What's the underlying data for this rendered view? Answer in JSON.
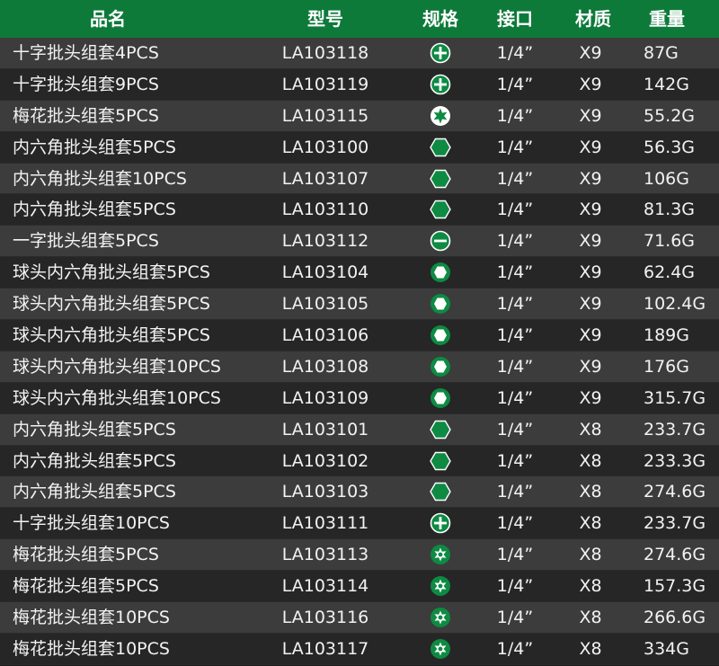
{
  "header": {
    "name": "品名",
    "model": "型号",
    "spec": "规格",
    "drive": "接口",
    "material": "材质",
    "weight": "重量"
  },
  "colors": {
    "header_bg": "#0e7a3a",
    "icon_green": "#0e8a43"
  },
  "rows": [
    {
      "name": "十字批头组套4PCS",
      "model": "LA103118",
      "icon": "phillips-icon",
      "drive": "1/4”",
      "material": "X9",
      "weight": "87G"
    },
    {
      "name": "十字批头组套9PCS",
      "model": "LA103119",
      "icon": "phillips-icon",
      "drive": "1/4”",
      "material": "X9",
      "weight": "142G"
    },
    {
      "name": "梅花批头组套5PCS",
      "model": "LA103115",
      "icon": "torx-icon",
      "drive": "1/4”",
      "material": "X9",
      "weight": "55.2G"
    },
    {
      "name": "内六角批头组套5PCS",
      "model": "LA103100",
      "icon": "hex-icon",
      "drive": "1/4”",
      "material": "X9",
      "weight": "56.3G"
    },
    {
      "name": "内六角批头组套10PCS",
      "model": "LA103107",
      "icon": "hex-icon",
      "drive": "1/4”",
      "material": "X9",
      "weight": "106G"
    },
    {
      "name": "内六角批头组套5PCS",
      "model": "LA103110",
      "icon": "hex-icon",
      "drive": "1/4”",
      "material": "X9",
      "weight": "81.3G"
    },
    {
      "name": "一字批头组套5PCS",
      "model": "LA103112",
      "icon": "slotted-icon",
      "drive": "1/4”",
      "material": "X9",
      "weight": "71.6G"
    },
    {
      "name": "球头内六角批头组套5PCS",
      "model": "LA103104",
      "icon": "ball-hex-icon",
      "drive": "1/4”",
      "material": "X9",
      "weight": "62.4G"
    },
    {
      "name": "球头内六角批头组套5PCS",
      "model": "LA103105",
      "icon": "ball-hex-icon",
      "drive": "1/4”",
      "material": "X9",
      "weight": "102.4G"
    },
    {
      "name": "球头内六角批头组套5PCS",
      "model": "LA103106",
      "icon": "ball-hex-icon",
      "drive": "1/4”",
      "material": "X9",
      "weight": "189G"
    },
    {
      "name": "球头内六角批头组套10PCS",
      "model": "LA103108",
      "icon": "ball-hex-icon",
      "drive": "1/4”",
      "material": "X9",
      "weight": "176G"
    },
    {
      "name": "球头内六角批头组套10PCS",
      "model": "LA103109",
      "icon": "ball-hex-icon",
      "drive": "1/4”",
      "material": "X9",
      "weight": "315.7G"
    },
    {
      "name": "内六角批头组套5PCS",
      "model": "LA103101",
      "icon": "hex-icon",
      "drive": "1/4”",
      "material": "X8",
      "weight": "233.7G"
    },
    {
      "name": "内六角批头组套5PCS",
      "model": "LA103102",
      "icon": "hex-icon",
      "drive": "1/4”",
      "material": "X8",
      "weight": "233.3G"
    },
    {
      "name": "内六角批头组套5PCS",
      "model": "LA103103",
      "icon": "hex-icon",
      "drive": "1/4”",
      "material": "X8",
      "weight": "274.6G"
    },
    {
      "name": "十字批头组套10PCS",
      "model": "LA103111",
      "icon": "phillips-icon",
      "drive": "1/4”",
      "material": "X8",
      "weight": "233.7G"
    },
    {
      "name": "梅花批头组套5PCS",
      "model": "LA103113",
      "icon": "security-torx-icon",
      "drive": "1/4”",
      "material": "X8",
      "weight": "274.6G"
    },
    {
      "name": "梅花批头组套5PCS",
      "model": "LA103114",
      "icon": "security-torx-icon",
      "drive": "1/4”",
      "material": "X8",
      "weight": "157.3G"
    },
    {
      "name": "梅花批头组套10PCS",
      "model": "LA103116",
      "icon": "security-torx-icon",
      "drive": "1/4”",
      "material": "X8",
      "weight": "266.6G"
    },
    {
      "name": "梅花批头组套10PCS",
      "model": "LA103117",
      "icon": "security-torx-icon",
      "drive": "1/4”",
      "material": "X8",
      "weight": "334G"
    }
  ]
}
